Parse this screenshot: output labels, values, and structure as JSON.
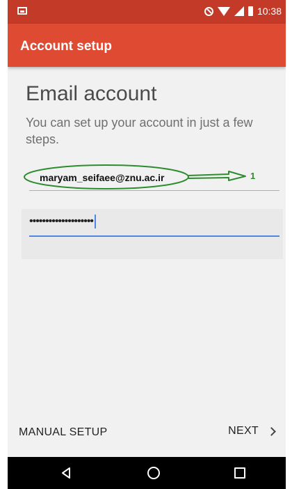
{
  "status_bar": {
    "time": "10:38",
    "icons": [
      "notification-icon",
      "dnd-icon",
      "wifi-icon",
      "signal-icon",
      "battery-icon"
    ]
  },
  "app_bar": {
    "title": "Account setup"
  },
  "main": {
    "heading": "Email account",
    "subheading": "You can set up your account in just a few steps.",
    "email_value": "maryam_seifaee@znu.ac.ir",
    "password_value": "••••••••••••••••••••"
  },
  "annotation": {
    "number": "1",
    "color": "#2e8b2e"
  },
  "bottom": {
    "manual_setup": "MANUAL SETUP",
    "next": "NEXT"
  },
  "nav": {
    "icons": [
      "back-icon",
      "home-icon",
      "recents-icon"
    ]
  },
  "colors": {
    "status_bar": "#c43a28",
    "app_bar": "#df4a33",
    "accent": "#4f86e4",
    "background": "#f1f1f1"
  }
}
